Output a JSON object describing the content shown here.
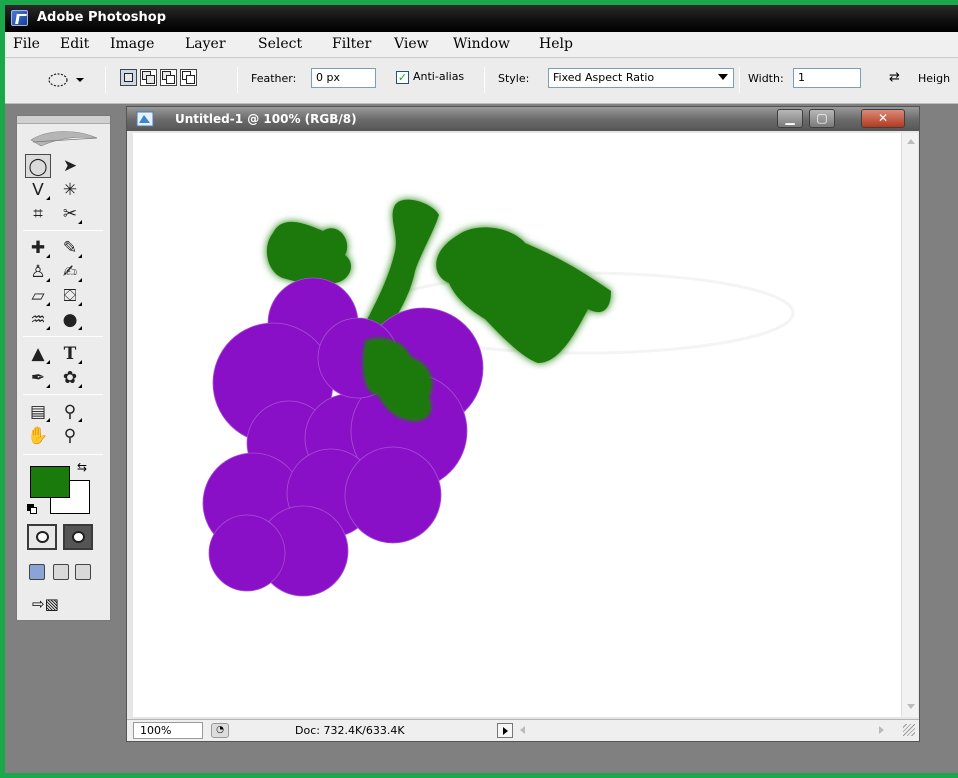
{
  "app": {
    "title": "Adobe Photoshop"
  },
  "menu": [
    "File",
    "Edit",
    "Image",
    "Layer",
    "Select",
    "Filter",
    "View",
    "Window",
    "Help"
  ],
  "options_bar": {
    "feather_label": "Feather:",
    "feather_value": "0 px",
    "antialias_label": "Anti-alias",
    "antialias_checked": true,
    "style_label": "Style:",
    "style_value": "Fixed Aspect Ratio",
    "width_label": "Width:",
    "width_value": "1",
    "height_label": "Heigh"
  },
  "toolbox": {
    "tools": [
      {
        "name": "elliptical-marquee-tool",
        "glyph": "◯",
        "active": true
      },
      {
        "name": "move-tool",
        "glyph": "➤"
      },
      {
        "name": "lasso-tool",
        "glyph": "ᐯ"
      },
      {
        "name": "magic-wand-tool",
        "glyph": "✳"
      },
      {
        "name": "crop-tool",
        "glyph": "⌗"
      },
      {
        "name": "slice-tool",
        "glyph": "✂"
      },
      {
        "name": "healing-brush-tool",
        "glyph": "✚"
      },
      {
        "name": "brush-tool",
        "glyph": "✎"
      },
      {
        "name": "clone-stamp-tool",
        "glyph": "♙"
      },
      {
        "name": "history-brush-tool",
        "glyph": "✍"
      },
      {
        "name": "eraser-tool",
        "glyph": "▱"
      },
      {
        "name": "paint-bucket-tool",
        "glyph": "⛋"
      },
      {
        "name": "blur-tool",
        "glyph": "✋"
      },
      {
        "name": "dodge-tool",
        "glyph": "●"
      },
      {
        "name": "path-selection-tool",
        "glyph": "▲"
      },
      {
        "name": "type-tool",
        "glyph": "T"
      },
      {
        "name": "pen-tool",
        "glyph": "✒"
      },
      {
        "name": "custom-shape-tool",
        "glyph": "✿"
      },
      {
        "name": "notes-tool",
        "glyph": "▤"
      },
      {
        "name": "eyedropper-tool",
        "glyph": "⚲"
      },
      {
        "name": "hand-tool",
        "glyph": "✋"
      },
      {
        "name": "zoom-tool",
        "glyph": "🔍"
      }
    ],
    "foreground_color": "#1a7a0c",
    "background_color": "#ffffff"
  },
  "document": {
    "title": "Untitled-1 @ 100% (RGB/8)",
    "zoom": "100%",
    "doc_size": "Doc: 732.4K/633.4K",
    "grapes_color": "#8a10c8",
    "leaf_color": "#1a7a0c"
  }
}
